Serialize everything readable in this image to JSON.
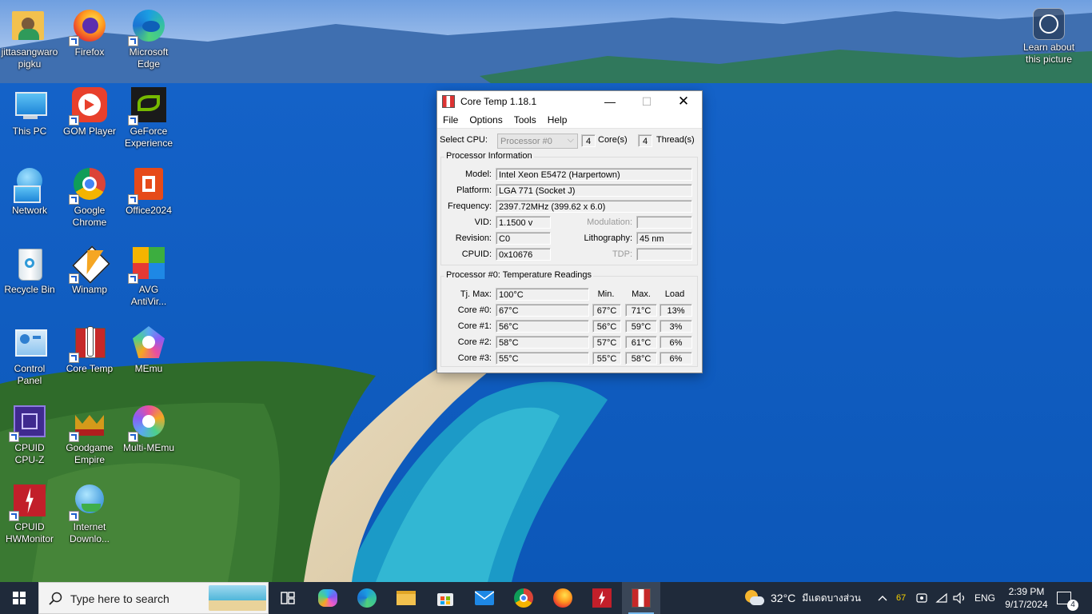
{
  "desktop": {
    "icons": [
      {
        "label": "jittasangwaro\npigku",
        "icon": "user-folder-icon"
      },
      {
        "label": "Firefox",
        "icon": "firefox-icon"
      },
      {
        "label": "Microsoft\nEdge",
        "icon": "edge-icon"
      },
      {
        "label": "This PC",
        "icon": "this-pc-icon"
      },
      {
        "label": "GOM Player",
        "icon": "gom-player-icon"
      },
      {
        "label": "GeForce\nExperience",
        "icon": "geforce-icon"
      },
      {
        "label": "Network",
        "icon": "network-icon"
      },
      {
        "label": "Google\nChrome",
        "icon": "chrome-icon"
      },
      {
        "label": "Office2024",
        "icon": "office-icon"
      },
      {
        "label": "Recycle Bin",
        "icon": "recycle-bin-icon"
      },
      {
        "label": "Winamp",
        "icon": "winamp-icon"
      },
      {
        "label": "AVG\nAntiVir...",
        "icon": "avg-icon"
      },
      {
        "label": "Control\nPanel",
        "icon": "control-panel-icon"
      },
      {
        "label": "Core Temp",
        "icon": "core-temp-icon"
      },
      {
        "label": "MEmu",
        "icon": "memu-icon"
      },
      {
        "label": "CPUID\nCPU-Z",
        "icon": "cpuz-icon"
      },
      {
        "label": "Goodgame\nEmpire",
        "icon": "goodgame-icon"
      },
      {
        "label": "Multi-MEmu",
        "icon": "multi-memu-icon"
      },
      {
        "label": "CPUID\nHWMonitor",
        "icon": "hwmonitor-icon"
      },
      {
        "label": "Internet\nDownlo...",
        "icon": "idm-icon"
      }
    ],
    "learn_about": "Learn about\nthis picture"
  },
  "window": {
    "title": "Core Temp 1.18.1",
    "menu": [
      "File",
      "Options",
      "Tools",
      "Help"
    ],
    "select_cpu_label": "Select CPU:",
    "select_cpu_value": "Processor #0",
    "cores_count": "4",
    "cores_label": "Core(s)",
    "threads_count": "4",
    "threads_label": "Thread(s)",
    "proc_info_title": "Processor Information",
    "model_label": "Model:",
    "model_value": "Intel Xeon E5472 (Harpertown)",
    "platform_label": "Platform:",
    "platform_value": "LGA 771 (Socket J)",
    "frequency_label": "Frequency:",
    "frequency_value": "2397.72MHz (399.62 x 6.0)",
    "vid_label": "VID:",
    "vid_value": "1.1500 v",
    "modulation_label": "Modulation:",
    "modulation_value": "",
    "revision_label": "Revision:",
    "revision_value": "C0",
    "lithography_label": "Lithography:",
    "lithography_value": "45 nm",
    "cpuid_label": "CPUID:",
    "cpuid_value": "0x10676",
    "tdp_label": "TDP:",
    "tdp_value": "",
    "temp_title": "Processor #0: Temperature Readings",
    "tjmax_label": "Tj. Max:",
    "tjmax_value": "100°C",
    "col_min": "Min.",
    "col_max": "Max.",
    "col_load": "Load",
    "cores": [
      {
        "label": "Core #0:",
        "temp": "67°C",
        "min": "67°C",
        "max": "71°C",
        "load": "13%"
      },
      {
        "label": "Core #1:",
        "temp": "56°C",
        "min": "56°C",
        "max": "59°C",
        "load": "3%"
      },
      {
        "label": "Core #2:",
        "temp": "58°C",
        "min": "57°C",
        "max": "61°C",
        "load": "6%"
      },
      {
        "label": "Core #3:",
        "temp": "55°C",
        "min": "55°C",
        "max": "58°C",
        "load": "6%"
      }
    ]
  },
  "taskbar": {
    "search_placeholder": "Type here to search",
    "weather_temp": "32°C",
    "weather_text": "มีแดดบางส่วน",
    "tray_number": "67",
    "language": "ENG",
    "time": "2:39 PM",
    "date": "9/17/2024",
    "notification_count": "4",
    "accent": "#76b9ed"
  }
}
